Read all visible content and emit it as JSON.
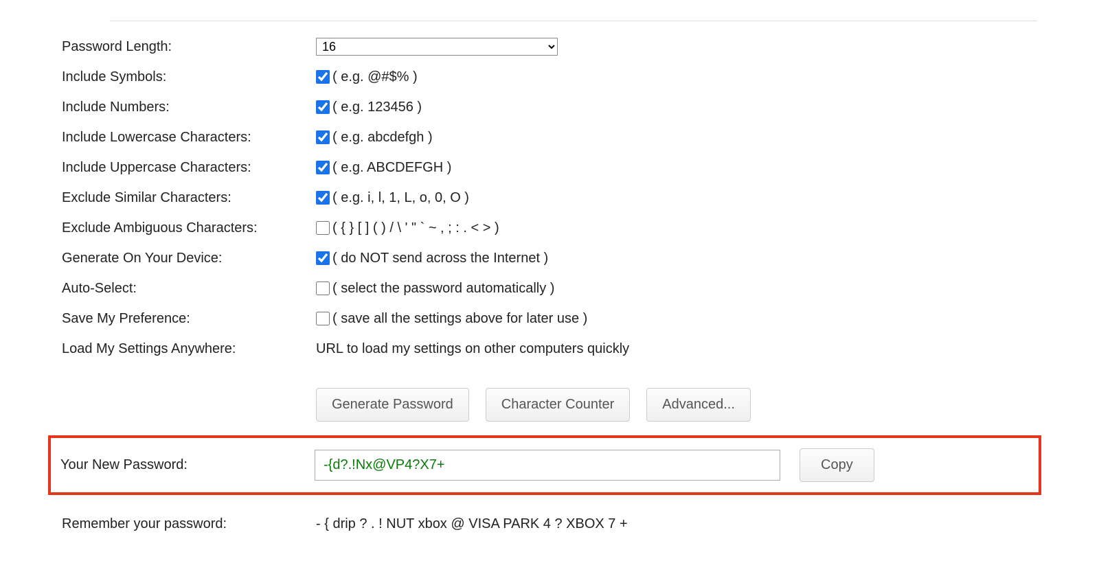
{
  "options": {
    "length": {
      "label": "Password Length:",
      "value": "16"
    },
    "symbols": {
      "label": "Include Symbols:",
      "checked": true,
      "hint": "( e.g. @#$% )"
    },
    "numbers": {
      "label": "Include Numbers:",
      "checked": true,
      "hint": "( e.g. 123456 )"
    },
    "lowercase": {
      "label": "Include Lowercase Characters:",
      "checked": true,
      "hint": "( e.g. abcdefgh )"
    },
    "uppercase": {
      "label": "Include Uppercase Characters:",
      "checked": true,
      "hint": "( e.g. ABCDEFGH )"
    },
    "similar": {
      "label": "Exclude Similar Characters:",
      "checked": true,
      "hint": "( e.g. i, l, 1, L, o, 0, O )"
    },
    "ambiguous": {
      "label": "Exclude Ambiguous Characters:",
      "checked": false,
      "hint": "( { } [ ] ( ) / \\ ' \" ` ~ , ; : . < > )"
    },
    "local": {
      "label": "Generate On Your Device:",
      "checked": true,
      "hint": "( do NOT send across the Internet )"
    },
    "autoselect": {
      "label": "Auto-Select:",
      "checked": false,
      "hint": "( select the password automatically )"
    },
    "savepref": {
      "label": "Save My Preference:",
      "checked": false,
      "hint": "( save all the settings above for later use )"
    },
    "loadanywhere": {
      "label": "Load My Settings Anywhere:",
      "text": "URL to load my settings on other computers quickly"
    }
  },
  "buttons": {
    "generate": "Generate Password",
    "counter": "Character Counter",
    "advanced": "Advanced...",
    "copy": "Copy"
  },
  "result": {
    "label": "Your New Password:",
    "value": "-{d?.!Nx@VP4?X7+"
  },
  "mnemonic": {
    "label": "Remember your password:",
    "value": "- { drip ? . ! NUT xbox @ VISA PARK 4 ? XBOX 7 +"
  }
}
